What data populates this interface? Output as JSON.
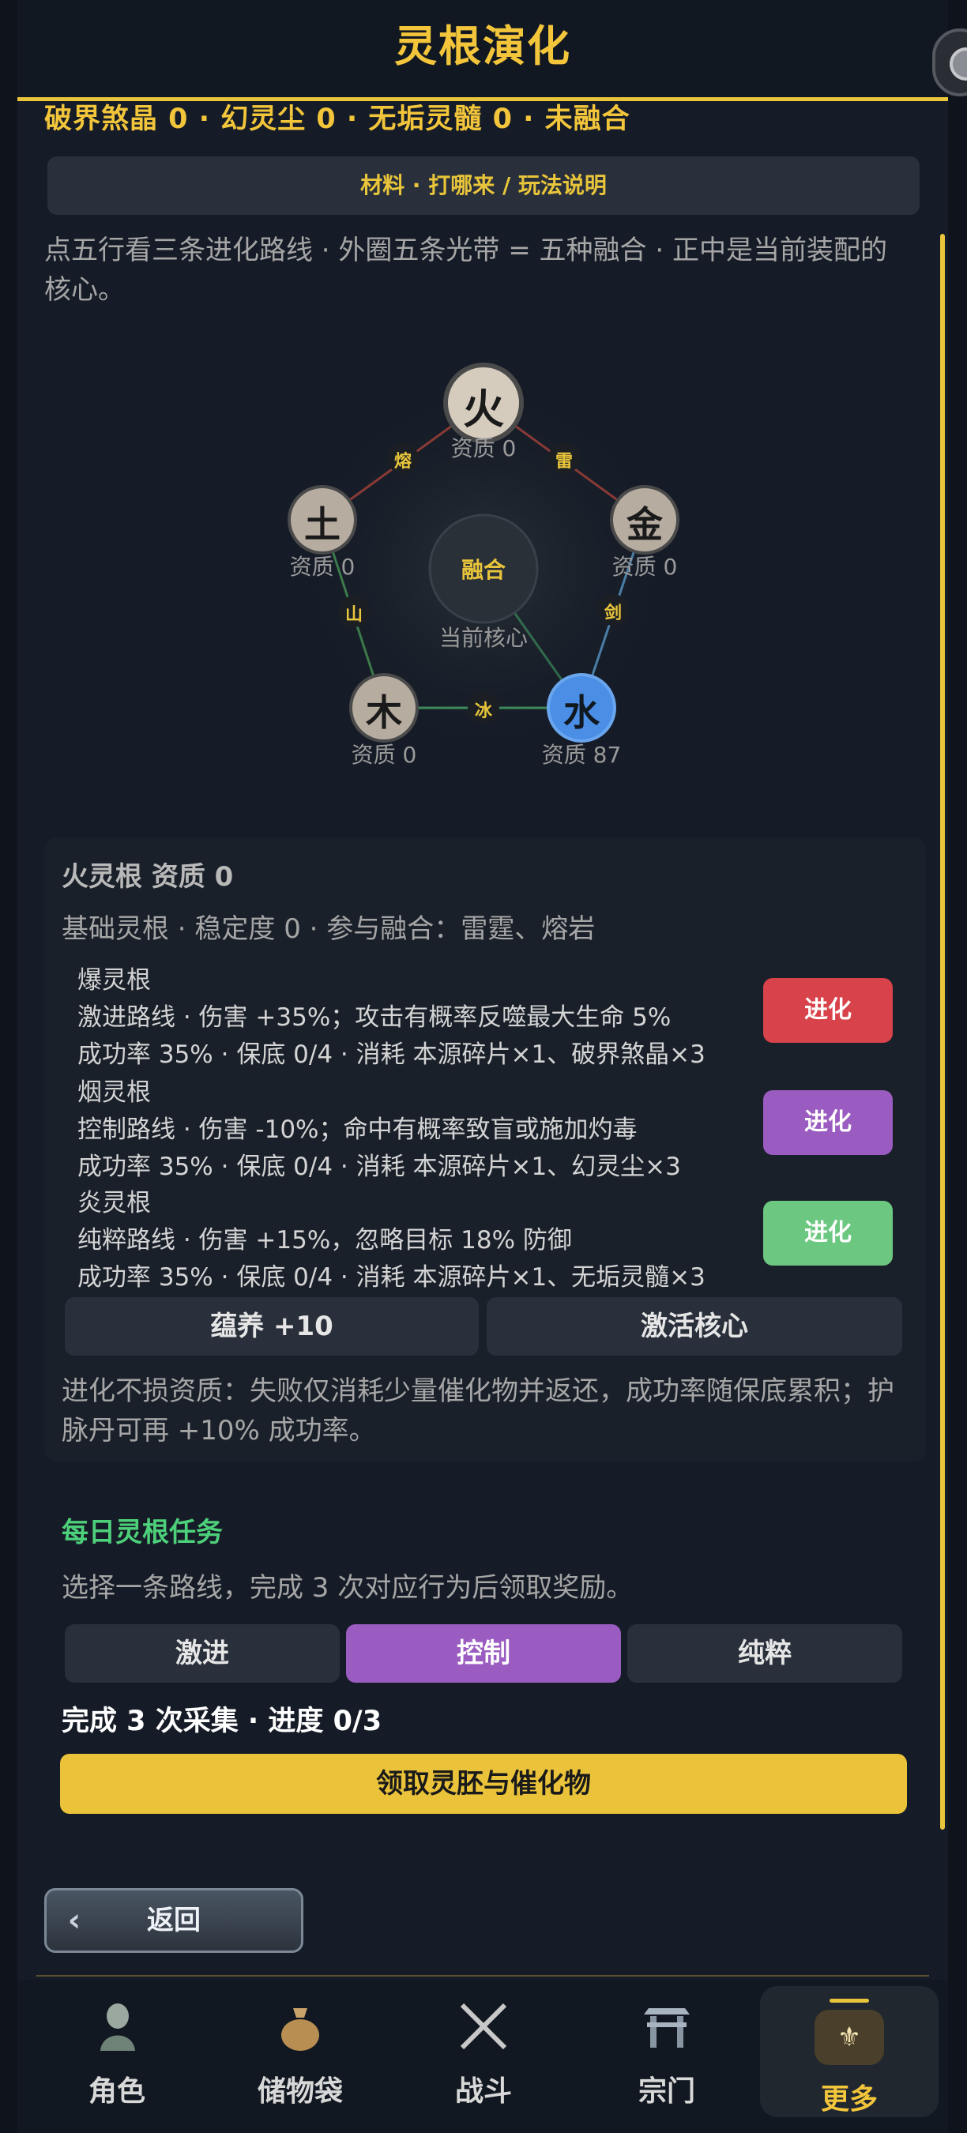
{
  "header": {
    "title": "灵根演化"
  },
  "materials_line": "破界煞晶 0 · 幻灵尘 0 · 无垢灵髓 0 · 未融合",
  "info_button": "材料 · 打哪来 / 玩法说明",
  "description": "点五行看三条进化路线 · 外圈五条光带 = 五种融合 · 正中是当前装配的核心。",
  "pentagon": {
    "center_label": "融合",
    "center_caption": "当前核心",
    "nodes": {
      "fire": {
        "glyph": "火",
        "caption": "资质 0"
      },
      "metal": {
        "glyph": "金",
        "caption": "资质 0"
      },
      "water": {
        "glyph": "水",
        "caption": "资质 87"
      },
      "wood": {
        "glyph": "木",
        "caption": "资质 0"
      },
      "earth": {
        "glyph": "土",
        "caption": "资质 0"
      }
    },
    "links": {
      "fire_metal": "雷",
      "metal_water": "剑",
      "water_wood": "冰",
      "wood_earth": "山",
      "earth_fire": "熔"
    }
  },
  "card": {
    "title": "火灵根  资质 0",
    "subtitle": "基础灵根 · 稳定度 0 · 参与融合：雷霆、熔岩",
    "evolutions": [
      {
        "name": "爆灵根",
        "desc": "激进路线 · 伤害 +35%；攻击有概率反噬最大生命 5%",
        "cost": "成功率 35% · 保底 0/4 · 消耗 本源碎片×1、破界煞晶×3",
        "button": "进化",
        "color": "#d8424a"
      },
      {
        "name": "烟灵根",
        "desc": "控制路线 · 伤害 -10%；命中有概率致盲或施加灼毒",
        "cost": "成功率 35% · 保底 0/4 · 消耗 本源碎片×1、幻灵尘×3",
        "button": "进化",
        "color": "#9a5cc0"
      },
      {
        "name": "炎灵根",
        "desc": "纯粹路线 · 伤害 +15%，忽略目标 18% 防御",
        "cost": "成功率 35% · 保底 0/4 · 消耗 本源碎片×1、无垢灵髓×3",
        "button": "进化",
        "color": "#6cc780"
      }
    ],
    "nurture_button": "蕴养 +10",
    "activate_button": "激活核心",
    "note": "进化不损资质：失败仅消耗少量催化物并返还，成功率随保底累积；护脉丹可再 +10% 成功率。"
  },
  "daily": {
    "title": "每日灵根任务",
    "subtitle": "选择一条路线，完成 3 次对应行为后领取奖励。",
    "routes": [
      "激进",
      "控制",
      "纯粹"
    ],
    "selected_route": "控制",
    "selected_color": "#9a5cc0",
    "progress": "完成 3 次采集 · 进度 0/3",
    "claim_button": "领取灵胚与催化物"
  },
  "back_button": "返回",
  "nav": {
    "items": [
      {
        "label": "角色",
        "icon": "character-icon"
      },
      {
        "label": "储物袋",
        "icon": "bag-icon"
      },
      {
        "label": "战斗",
        "icon": "swords-icon"
      },
      {
        "label": "宗门",
        "icon": "sect-gate-icon"
      },
      {
        "label": "更多",
        "icon": "more-icon"
      }
    ],
    "active": "更多"
  },
  "colors": {
    "accent": "#e8c53a",
    "water": "#4a8ee6",
    "daily_title": "#4dd07a"
  }
}
